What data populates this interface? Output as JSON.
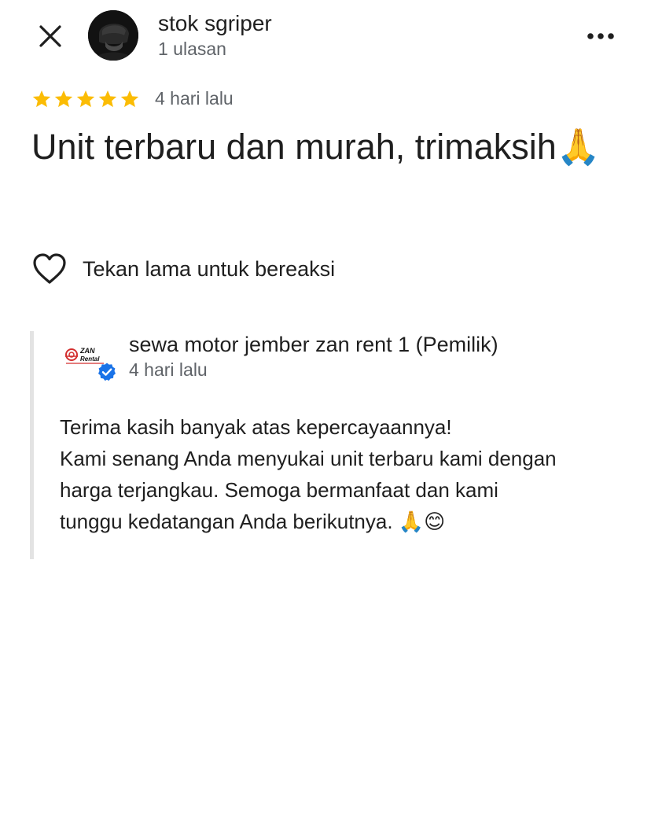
{
  "header": {
    "close_icon": "close-icon",
    "reviewer_name": "stok sgriper",
    "reviewer_review_count": "1 ulasan",
    "more_icon": "more-horizontal-icon"
  },
  "review": {
    "rating": 5,
    "rating_max": 5,
    "star_color": "#fbbc04",
    "date": "4 hari lalu",
    "text": "Unit terbaru dan murah, trimaksih🙏"
  },
  "reaction": {
    "icon": "heart-outline-icon",
    "label": "Tekan lama untuk bereaksi"
  },
  "owner_response": {
    "logo_text": "ZAN Rental",
    "verified_icon": "verified-check-icon",
    "verified_color": "#1a73e8",
    "name": "sewa motor jember zan rent 1 (Pemilik)",
    "date": "4 hari lalu",
    "lines": [
      "Terima kasih banyak atas kepercayaannya!",
      "Kami senang Anda menyukai unit terbaru kami dengan",
      "harga terjangkau. Semoga bermanfaat dan kami",
      "tunggu kedatangan Anda berikutnya. 🙏😊"
    ]
  }
}
